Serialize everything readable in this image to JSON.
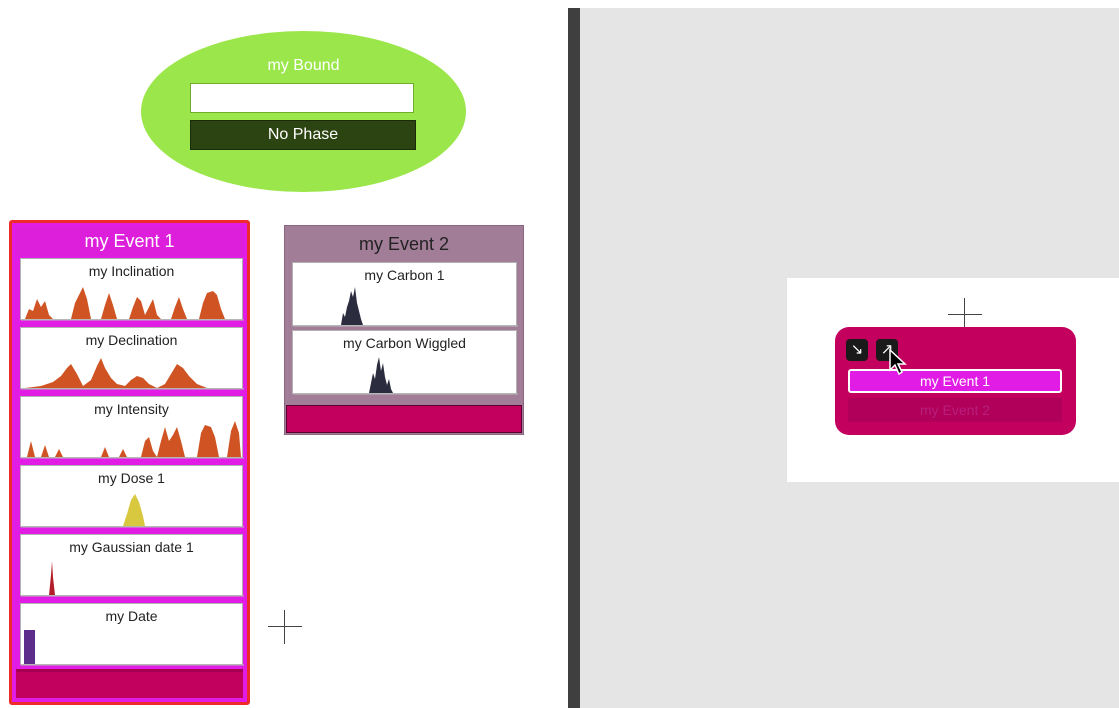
{
  "bound": {
    "title": "my Bound",
    "input_value": "",
    "phase_button": "No Phase"
  },
  "event1": {
    "title": "my Event 1",
    "dates": [
      {
        "label": "my Inclination",
        "color": "#d05423"
      },
      {
        "label": "my Declination",
        "color": "#d05423"
      },
      {
        "label": "my Intensity",
        "color": "#d05423"
      },
      {
        "label": "my Dose 1",
        "color": "#d8c840"
      },
      {
        "label": "my Gaussian date 1",
        "color": "#b21e2a"
      },
      {
        "label": "my Date",
        "color": "#5c2d8a"
      }
    ]
  },
  "event2": {
    "title": "my Event 2",
    "dates": [
      {
        "label": "my Carbon 1",
        "color": "#2b2d3f"
      },
      {
        "label": "my Carbon Wiggled",
        "color": "#2b2d3f"
      }
    ]
  },
  "overview": {
    "items": [
      "my Event 1",
      "my Event 2"
    ],
    "icons": [
      "collapse-icon",
      "expand-icon"
    ]
  }
}
